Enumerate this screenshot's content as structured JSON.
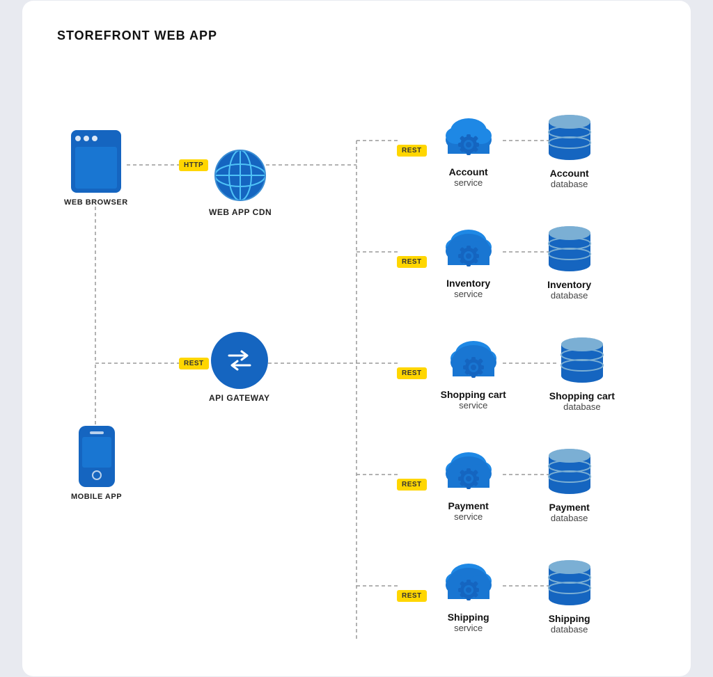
{
  "title": "STOREFRONT WEB APP",
  "left": {
    "browser_label": "WEB BROWSER",
    "mobile_label": "MOBILE APP"
  },
  "middle": {
    "cdn_label": "WEB APP CDN",
    "gateway_label": "API GATEWAY",
    "http_badge": "HTTP",
    "rest_badge": "REST"
  },
  "services": [
    {
      "id": "account",
      "name": "Account",
      "sub": "service",
      "db_name": "Account",
      "db_sub": "database",
      "badge": "REST"
    },
    {
      "id": "inventory",
      "name": "Inventory",
      "sub": "service",
      "db_name": "Inventory",
      "db_sub": "database",
      "badge": "REST"
    },
    {
      "id": "shopping-cart",
      "name": "Shopping cart",
      "sub": "service",
      "db_name": "Shopping cart",
      "db_sub": "database",
      "badge": "REST"
    },
    {
      "id": "payment",
      "name": "Payment",
      "sub": "service",
      "db_name": "Payment",
      "db_sub": "database",
      "badge": "REST"
    },
    {
      "id": "shipping",
      "name": "Shipping",
      "sub": "service",
      "db_name": "Shipping",
      "db_sub": "database",
      "badge": "REST"
    }
  ],
  "colors": {
    "blue_dark": "#1565C0",
    "blue_mid": "#1976D2",
    "blue_light": "#5B8BD9",
    "yellow": "#FFD600",
    "db_top": "#5B8BD9",
    "db_body": "#1565C0"
  }
}
